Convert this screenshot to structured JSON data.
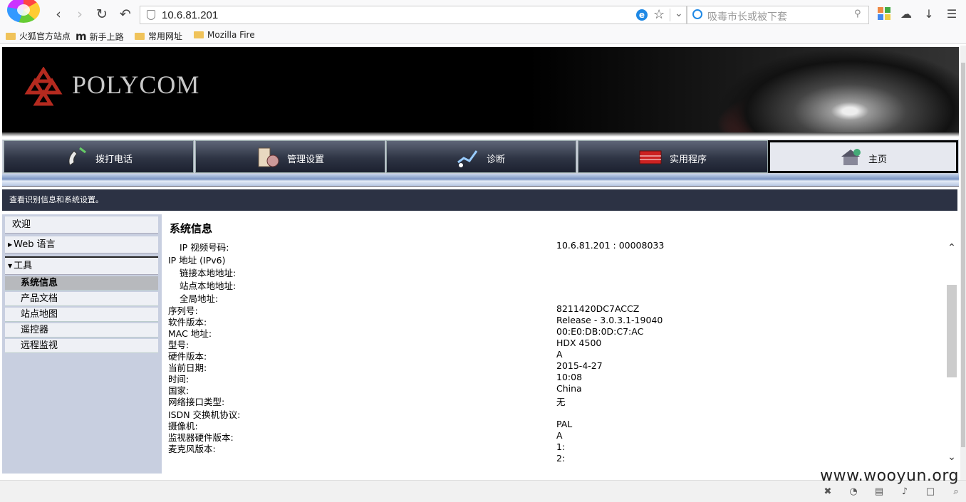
{
  "browser": {
    "url": "10.6.81.201",
    "search_placeholder": "吸毒市长或被下套",
    "bookmarks": [
      "火狐官方站点",
      "新手上路",
      "常用网址",
      "Mozilla Firefox"
    ]
  },
  "banner": {
    "brand": "POLYCOM"
  },
  "menu": [
    {
      "label": "拨打电话",
      "icon": "phone-icon"
    },
    {
      "label": "管理设置",
      "icon": "settings-icon"
    },
    {
      "label": "诊断",
      "icon": "diagnostics-icon"
    },
    {
      "label": "实用程序",
      "icon": "toolbox-icon"
    },
    {
      "label": "主页",
      "icon": "home-icon",
      "active": true
    }
  ],
  "description": "查看识别信息和系统设置。",
  "sidebar": {
    "welcome": "欢迎",
    "web_language": "Web 语言",
    "tools": "工具",
    "items": [
      "系统信息",
      "产品文档",
      "站点地图",
      "遥控器",
      "远程监视"
    ],
    "selected": "系统信息"
  },
  "system_info": {
    "title": "系统信息",
    "rows": [
      {
        "label": "IP 视频号码:",
        "value": "10.6.81.201 : 00008033",
        "indent": true
      },
      {
        "label": "IP 地址 (IPv6)",
        "value": ""
      },
      {
        "label": "链接本地地址:",
        "value": "",
        "indent": true
      },
      {
        "label": "站点本地地址:",
        "value": "",
        "indent": true
      },
      {
        "label": "全局地址:",
        "value": "",
        "indent": true
      },
      {
        "label": "序列号:",
        "value": "8211420DC7ACCZ"
      },
      {
        "label": "软件版本:",
        "value": "Release - 3.0.3.1-19040"
      },
      {
        "label": "MAC 地址:",
        "value": "00:E0:DB:0D:C7:AC"
      },
      {
        "label": "型号:",
        "value": "HDX 4500"
      },
      {
        "label": "硬件版本:",
        "value": "A"
      },
      {
        "label": "当前日期:",
        "value": "2015-4-27"
      },
      {
        "label": "时间:",
        "value": "10:08"
      },
      {
        "label": "国家:",
        "value": "China"
      },
      {
        "label": "网络接口类型:",
        "value": "无"
      },
      {
        "label": "ISDN 交换机协议:",
        "value": ""
      },
      {
        "label": "摄像机:",
        "value": "PAL"
      },
      {
        "label": "监视器硬件版本:",
        "value": "A"
      },
      {
        "label": "麦克风版本:",
        "value": "1:"
      },
      {
        "label": "",
        "value": "2:"
      }
    ]
  },
  "watermark": "www.wooyun.org"
}
